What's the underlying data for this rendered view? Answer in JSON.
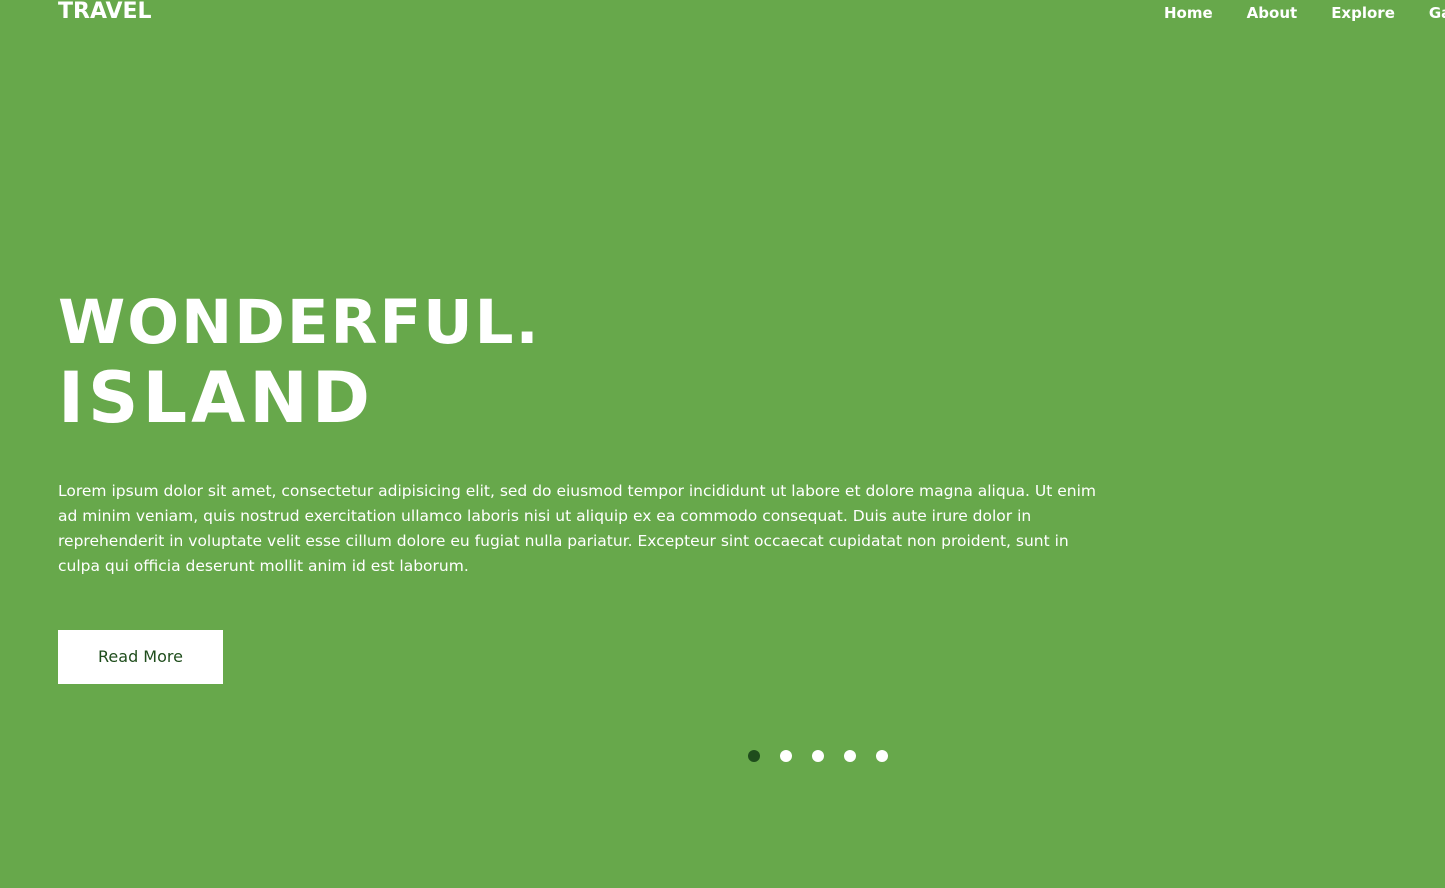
{
  "brand": {
    "logo": "TRAVEL"
  },
  "nav": {
    "items": [
      {
        "label": "Home"
      },
      {
        "label": "About"
      },
      {
        "label": "Explore"
      },
      {
        "label": "Ga"
      }
    ]
  },
  "hero": {
    "title_line1": "WONDERFUL.",
    "title_line2": "ISLAND",
    "description": "Lorem ipsum dolor sit amet, consectetur adipisicing elit, sed do eiusmod tempor incididunt ut labore et dolore magna aliqua. Ut enim ad minim veniam, quis nostrud exercitation ullamco laboris nisi ut aliquip ex ea commodo consequat. Duis aute irure dolor in reprehenderit in voluptate velit esse cillum dolore eu fugiat nulla pariatur. Excepteur sint occaecat cupidatat non proident, sunt in culpa qui officia deserunt mollit anim id est laborum.",
    "button_label": "Read More"
  },
  "carousel": {
    "slide_count": 5,
    "active_index": 0
  },
  "colors": {
    "background": "#67a84b",
    "text": "#ffffff",
    "button_text": "#1f4d1c",
    "active_dot": "#1f4d1c"
  }
}
